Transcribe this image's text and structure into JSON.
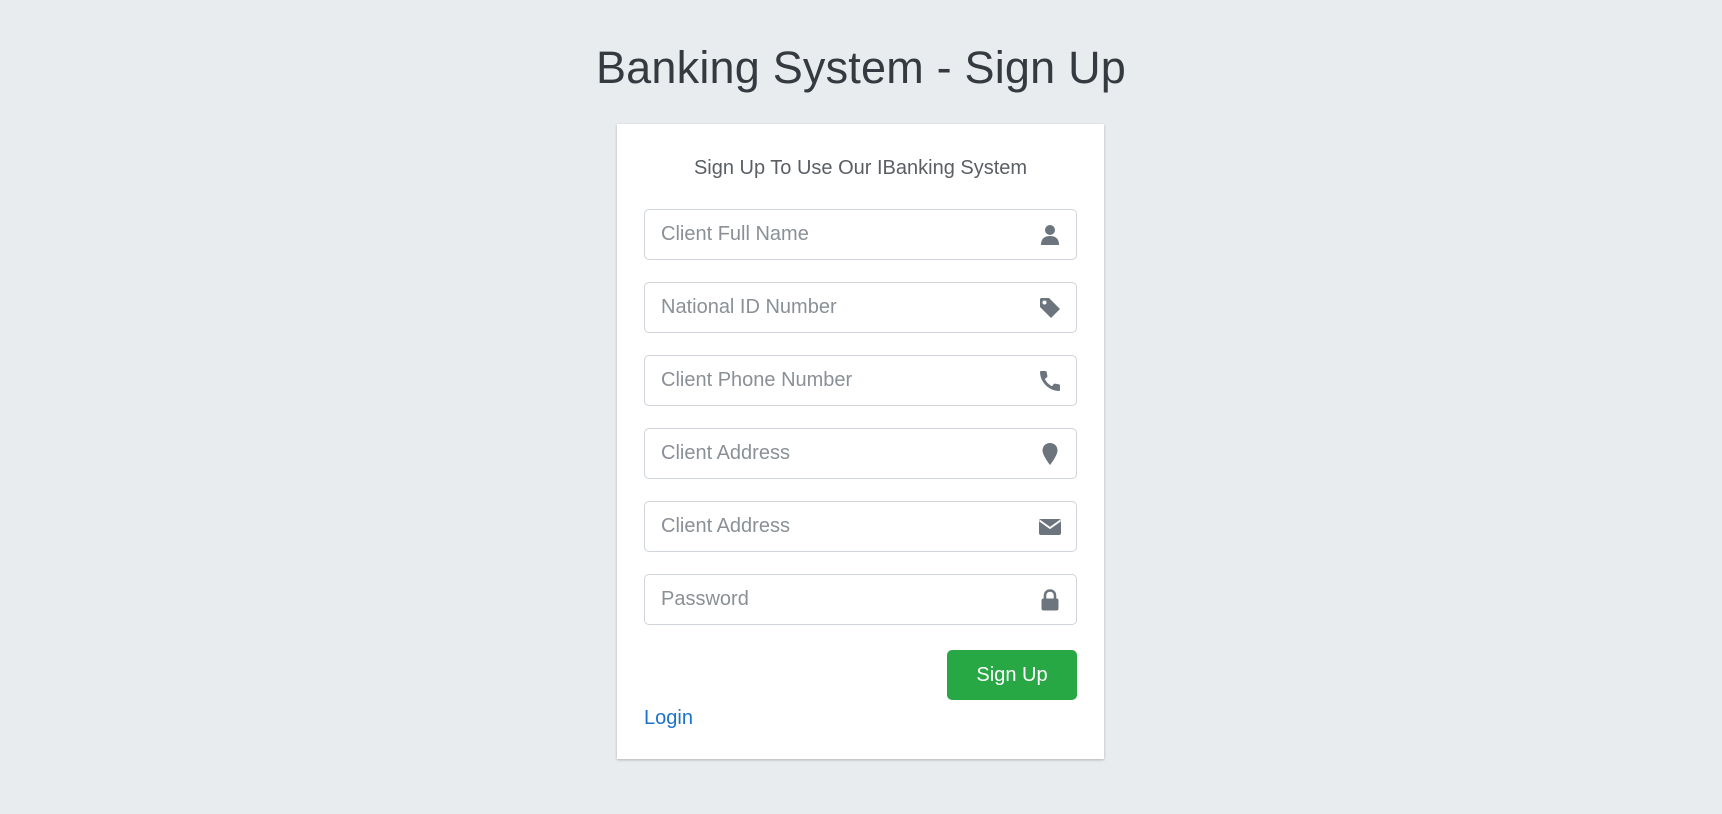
{
  "page": {
    "title": "Banking System - Sign Up"
  },
  "form": {
    "subtitle": "Sign Up To Use Our IBanking System",
    "fields": [
      {
        "placeholder": "Client Full Name",
        "value": "",
        "icon": "user-icon"
      },
      {
        "placeholder": "National ID Number",
        "value": "",
        "icon": "tag-icon"
      },
      {
        "placeholder": "Client Phone Number",
        "value": "",
        "icon": "phone-icon"
      },
      {
        "placeholder": "Client Address",
        "value": "",
        "icon": "map-marker-icon"
      },
      {
        "placeholder": "Client Address",
        "value": "",
        "icon": "envelope-icon"
      },
      {
        "placeholder": "Password",
        "value": "",
        "icon": "lock-icon"
      }
    ],
    "submit_label": "Sign Up",
    "login_link": "Login"
  },
  "colors": {
    "background": "#e9ecef",
    "primary_button": "#28a745",
    "link": "#1a73c8",
    "icon": "#6c757d"
  }
}
